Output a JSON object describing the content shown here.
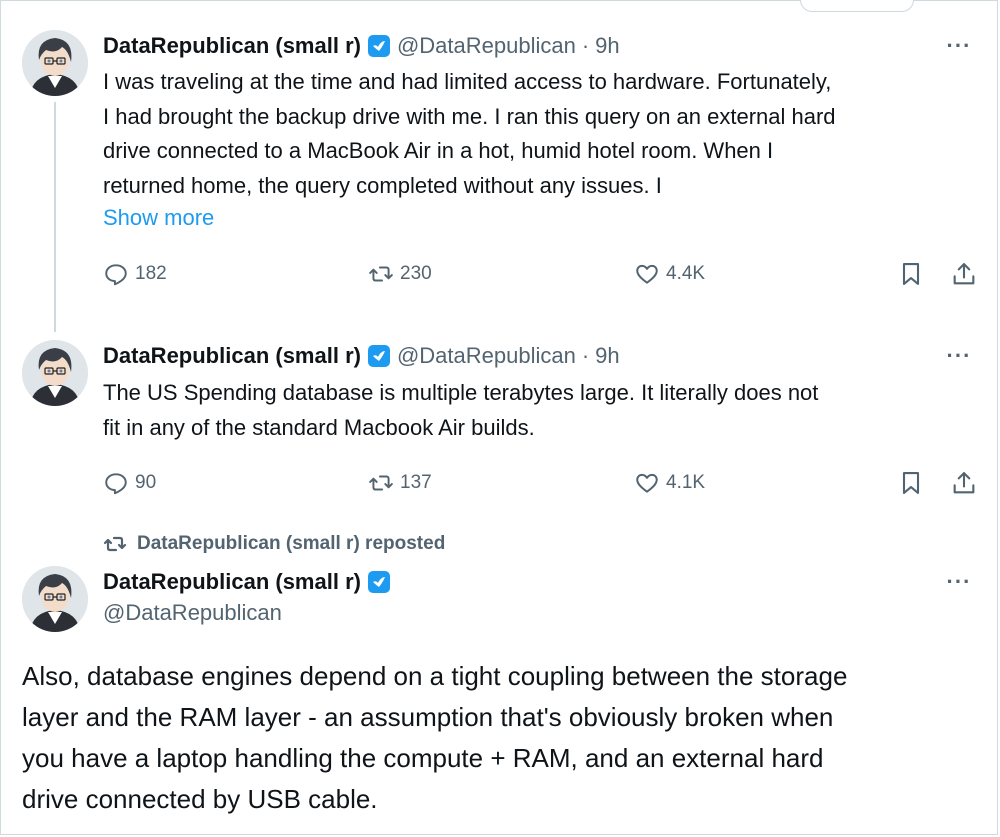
{
  "colors": {
    "accent": "#1d9bf0",
    "text": "#0f1419",
    "muted": "#536471"
  },
  "tweets": [
    {
      "name": "DataRepublican (small r)",
      "handle": "@DataRepublican",
      "separator": "·",
      "time": "9h",
      "lines": [
        "I was traveling at the time and had limited access to hardware. Fortunately,",
        "I had brought the backup drive with me. I ran this query on an external hard",
        "drive connected to a MacBook Air in a hot, humid hotel room. When I",
        "returned home, the query completed without any issues. I"
      ],
      "show_more": "Show more",
      "replies": "182",
      "reposts": "230",
      "likes": "4.4K"
    },
    {
      "name": "DataRepublican (small r)",
      "handle": "@DataRepublican",
      "separator": "·",
      "time": "9h",
      "lines": [
        "The US Spending database is multiple terabytes large. It literally does not",
        "fit in any of the standard Macbook Air builds."
      ],
      "replies": "90",
      "reposts": "137",
      "likes": "4.1K"
    }
  ],
  "reposted": {
    "label": "DataRepublican (small r) reposted",
    "name": "DataRepublican (small r)",
    "handle": "@DataRepublican",
    "lines": [
      "Also, database engines depend on a tight coupling between the storage",
      "layer and the RAM layer - an assumption that's obviously broken when",
      "you have a laptop handling the compute + RAM, and an external hard",
      "drive connected by USB cable."
    ]
  },
  "icons": {
    "avatar": "anime-avatar",
    "verified": "verified-badge-icon",
    "more": "more-horizontal-icon",
    "reply": "reply-icon",
    "repost": "repost-icon",
    "like": "heart-icon",
    "bookmark": "bookmark-icon",
    "share": "share-icon"
  }
}
